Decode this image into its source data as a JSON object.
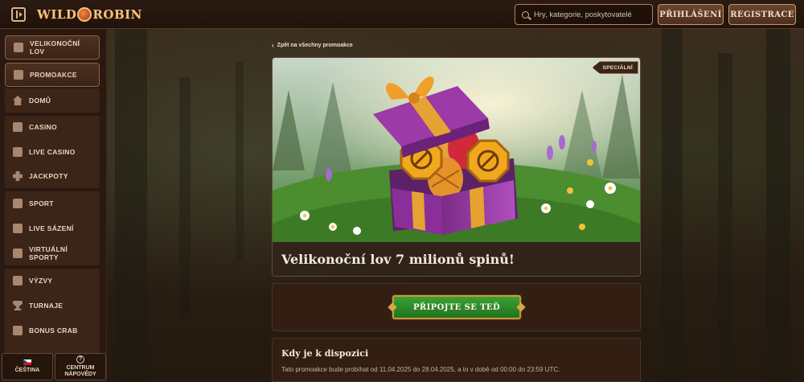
{
  "header": {
    "logo_text_left": "WILD",
    "logo_text_right": "ROBIN",
    "search_placeholder": "Hry, kategorie, poskytovatelé",
    "login_label": "PŘIHLÁŠENÍ",
    "register_label": "REGISTRACE"
  },
  "sidebar": {
    "items": [
      {
        "label": "VELIKONOČNÍ LOV",
        "icon": "egg-icon"
      },
      {
        "label": "PROMOAKCE",
        "icon": "gift-icon"
      },
      {
        "label": "DOMŮ",
        "icon": "home-icon"
      },
      {
        "label": "CASINO",
        "icon": "casino-icon"
      },
      {
        "label": "LIVE CASINO",
        "icon": "live-casino-icon"
      },
      {
        "label": "JACKPOTY",
        "icon": "jackpot-icon"
      },
      {
        "label": "SPORT",
        "icon": "sport-icon"
      },
      {
        "label": "LIVE SÁZENÍ",
        "icon": "live-betting-icon"
      },
      {
        "label": "VIRTUÁLNÍ SPORTY",
        "icon": "virtual-sports-icon"
      },
      {
        "label": "VÝZVY",
        "icon": "target-icon"
      },
      {
        "label": "TURNAJE",
        "icon": "trophy-icon"
      },
      {
        "label": "BONUS CRAB",
        "icon": "crab-icon"
      }
    ],
    "footer": {
      "language_label": "ČEŠTINA",
      "help_label": "CENTRUM NÁPOVĚDY"
    }
  },
  "promo": {
    "back_label": "Zpět na všechny promoakce",
    "badge": "SPECIÁLNÍ",
    "title": "Velikonoční lov 7 milionů spinů!",
    "join_label": "PŘIPOJTE SE TEĎ",
    "availability_title": "Kdy je k dispozici",
    "availability_text": "Tato promoakce bude probíhat od 11.04.2025 do 28.04.2025, a to v době od 00:00 do 23:59 UTC."
  },
  "colors": {
    "accent_green": "#2f8f2b",
    "accent_gold": "#c79a3c",
    "background": "#24150d"
  }
}
